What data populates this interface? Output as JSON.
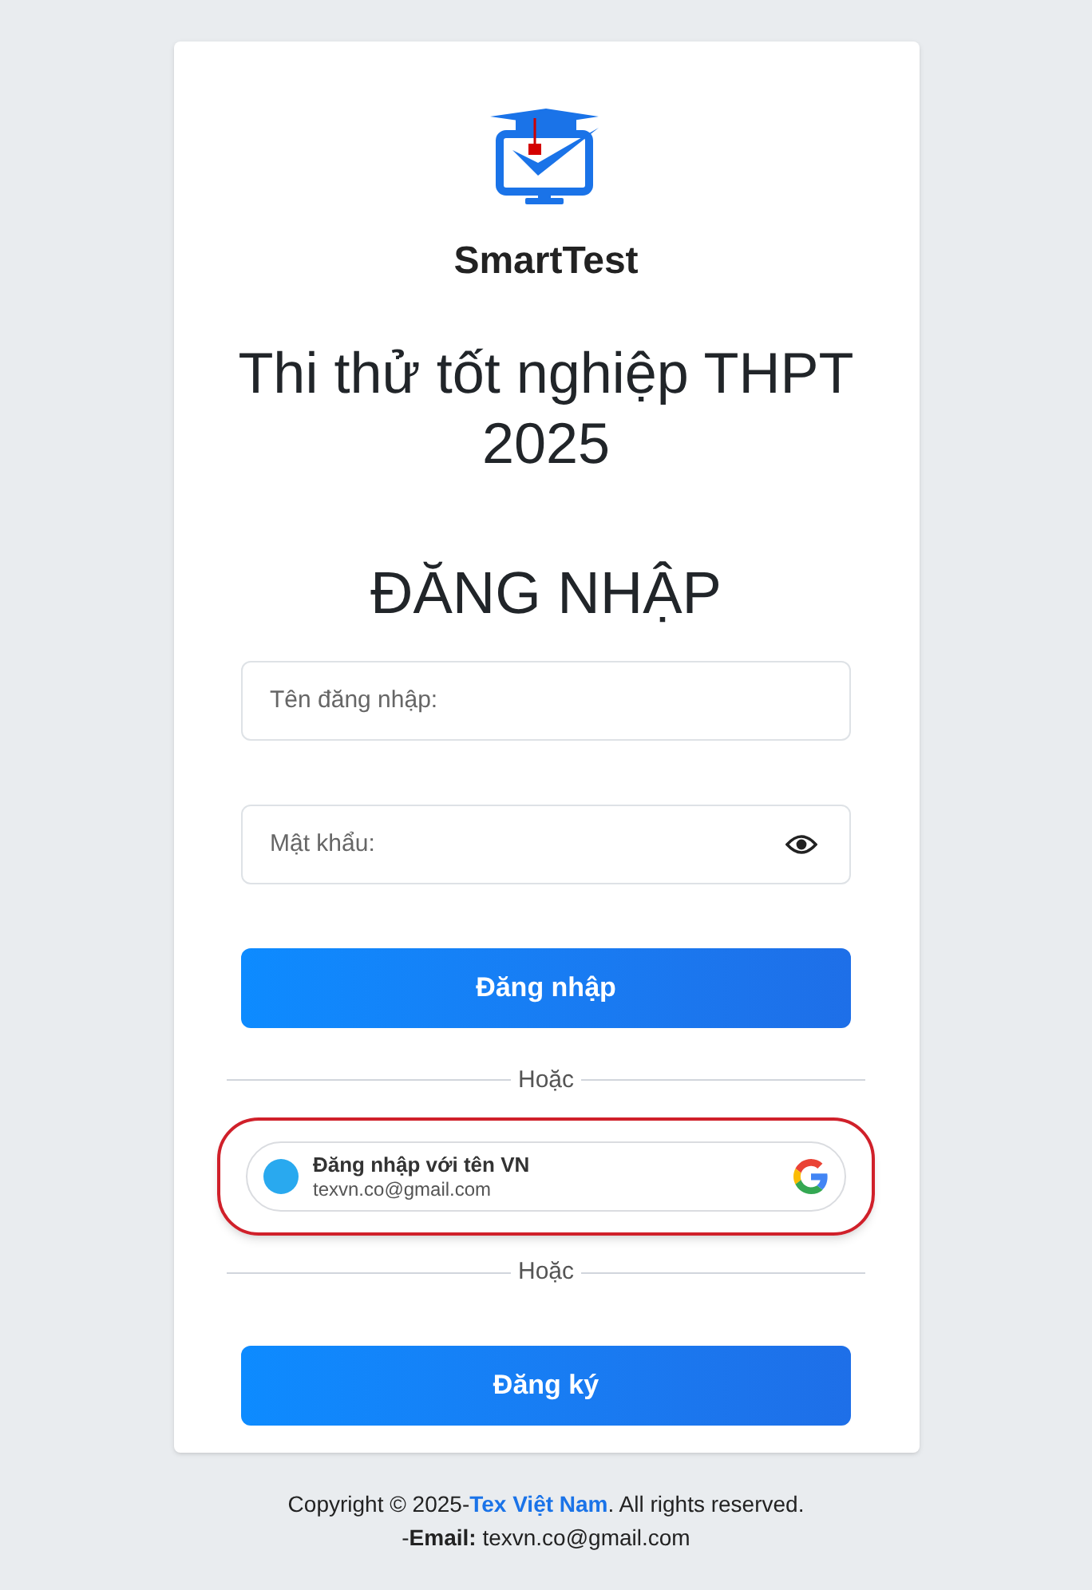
{
  "brand": {
    "name": "SmartTest"
  },
  "title": "Thi thử tốt nghiệp THPT 2025",
  "heading": "ĐĂNG NHẬP",
  "username": {
    "placeholder": "Tên đăng nhập:"
  },
  "password": {
    "placeholder": "Mật khẩu:"
  },
  "login_button": "Đăng nhập",
  "divider_1": "Hoặc",
  "google_account": {
    "name": "Đăng nhập với tên VN",
    "email": "texvn.co@gmail.com",
    "highlighted": true
  },
  "divider_2": "Hoặc",
  "register_button": "Đăng ký",
  "footer": {
    "copyright_prefix": "Copyright © 2025-",
    "company_link": "Tex Việt Nam",
    "copyright_suffix": ". All rights reserved.",
    "email_line": "-**Email:** texvn.co@gmail.com"
  }
}
